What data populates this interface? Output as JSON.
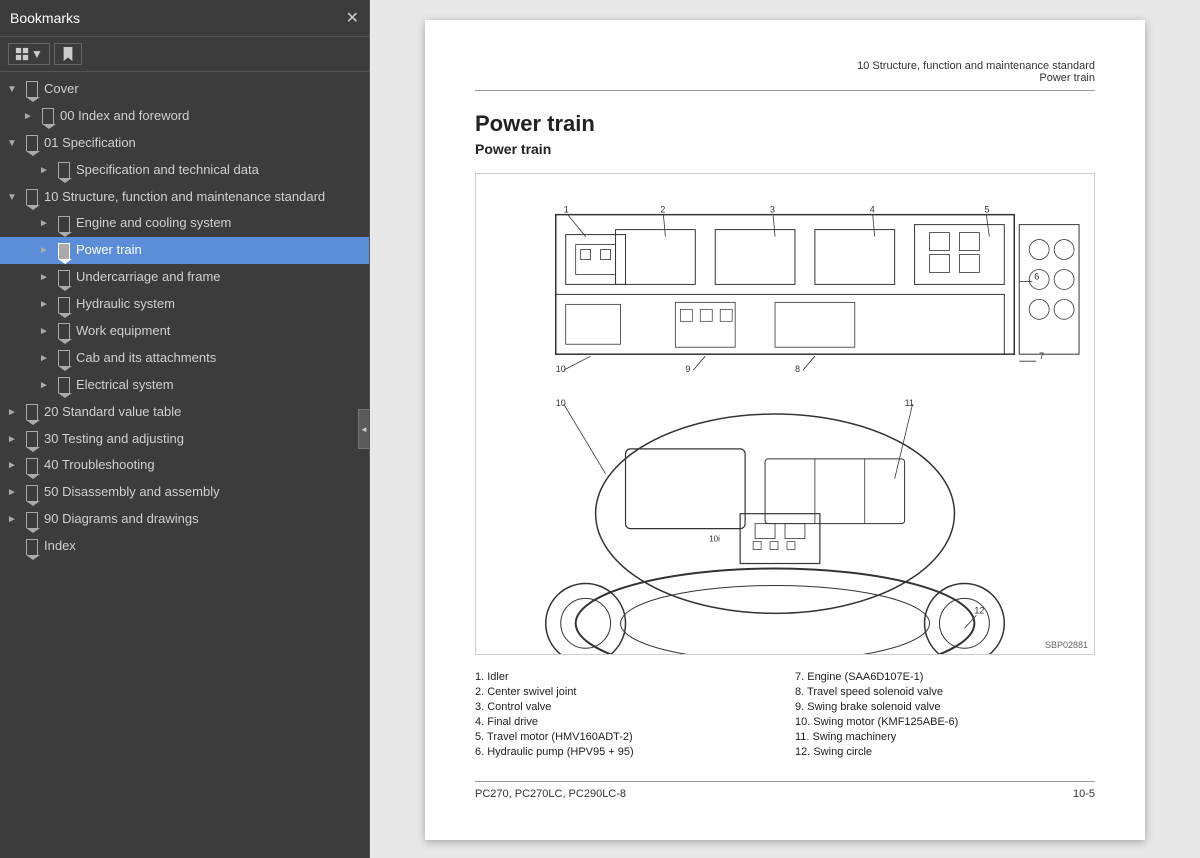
{
  "sidebar": {
    "title": "Bookmarks",
    "close_label": "✕",
    "toolbar": {
      "view_btn": "⊞",
      "bookmark_btn": "🔖"
    },
    "tree": [
      {
        "id": "cover",
        "label": "Cover",
        "level": 0,
        "indent": "indent-0",
        "expanded": true,
        "hasChildren": true,
        "selected": false
      },
      {
        "id": "index",
        "label": "00 Index and foreword",
        "level": 1,
        "indent": "indent-1",
        "expanded": false,
        "hasChildren": true,
        "selected": false
      },
      {
        "id": "spec",
        "label": "01 Specification",
        "level": 0,
        "indent": "indent-0",
        "expanded": true,
        "hasChildren": true,
        "selected": false
      },
      {
        "id": "spec-data",
        "label": "Specification and technical data",
        "level": 2,
        "indent": "indent-2",
        "expanded": false,
        "hasChildren": true,
        "selected": false
      },
      {
        "id": "struct",
        "label": "10 Structure, function and maintenance standard",
        "level": 0,
        "indent": "indent-0",
        "expanded": true,
        "hasChildren": true,
        "selected": false
      },
      {
        "id": "engine",
        "label": "Engine and cooling system",
        "level": 2,
        "indent": "indent-2",
        "expanded": false,
        "hasChildren": true,
        "selected": false
      },
      {
        "id": "power",
        "label": "Power train",
        "level": 2,
        "indent": "indent-2",
        "expanded": false,
        "hasChildren": true,
        "selected": true
      },
      {
        "id": "under",
        "label": "Undercarriage and frame",
        "level": 2,
        "indent": "indent-2",
        "expanded": false,
        "hasChildren": true,
        "selected": false
      },
      {
        "id": "hydraulic",
        "label": "Hydraulic system",
        "level": 2,
        "indent": "indent-2",
        "expanded": false,
        "hasChildren": true,
        "selected": false
      },
      {
        "id": "work",
        "label": "Work equipment",
        "level": 2,
        "indent": "indent-2",
        "expanded": false,
        "hasChildren": true,
        "selected": false
      },
      {
        "id": "cab",
        "label": "Cab and its attachments",
        "level": 2,
        "indent": "indent-2",
        "expanded": false,
        "hasChildren": true,
        "selected": false
      },
      {
        "id": "elec",
        "label": "Electrical system",
        "level": 2,
        "indent": "indent-2",
        "expanded": false,
        "hasChildren": true,
        "selected": false
      },
      {
        "id": "std",
        "label": "20 Standard value table",
        "level": 0,
        "indent": "indent-0",
        "expanded": false,
        "hasChildren": true,
        "selected": false
      },
      {
        "id": "test",
        "label": "30 Testing and adjusting",
        "level": 0,
        "indent": "indent-0",
        "expanded": false,
        "hasChildren": true,
        "selected": false
      },
      {
        "id": "trouble",
        "label": "40 Troubleshooting",
        "level": 0,
        "indent": "indent-0",
        "expanded": false,
        "hasChildren": true,
        "selected": false
      },
      {
        "id": "disasm",
        "label": "50 Disassembly and assembly",
        "level": 0,
        "indent": "indent-0",
        "expanded": false,
        "hasChildren": true,
        "selected": false
      },
      {
        "id": "diag",
        "label": "90 Diagrams and drawings",
        "level": 0,
        "indent": "indent-0",
        "expanded": false,
        "hasChildren": true,
        "selected": false
      },
      {
        "id": "idx",
        "label": "Index",
        "level": 0,
        "indent": "indent-0",
        "expanded": false,
        "hasChildren": false,
        "selected": false
      }
    ]
  },
  "document": {
    "header_line1": "10 Structure, function and maintenance standard",
    "header_line2": "Power train",
    "main_title": "Power train",
    "sub_title": "Power train",
    "diagram_ref": "SBP02881",
    "parts_list": [
      "1.   Idler",
      "2.   Center swivel joint",
      "3.   Control valve",
      "4.   Final drive",
      "5.   Travel motor (HMV160ADT-2)",
      "6.   Hydraulic pump (HPV95 + 95)",
      "7.   Engine (SAA6D107E-1)",
      "8.   Travel speed solenoid valve",
      "9.   Swing brake solenoid valve",
      "10.  Swing motor (KMF125ABE-6)",
      "11.  Swing machinery",
      "12.  Swing circle"
    ],
    "footer_left": "PC270, PC270LC, PC290LC-8",
    "footer_right": "10-5"
  }
}
